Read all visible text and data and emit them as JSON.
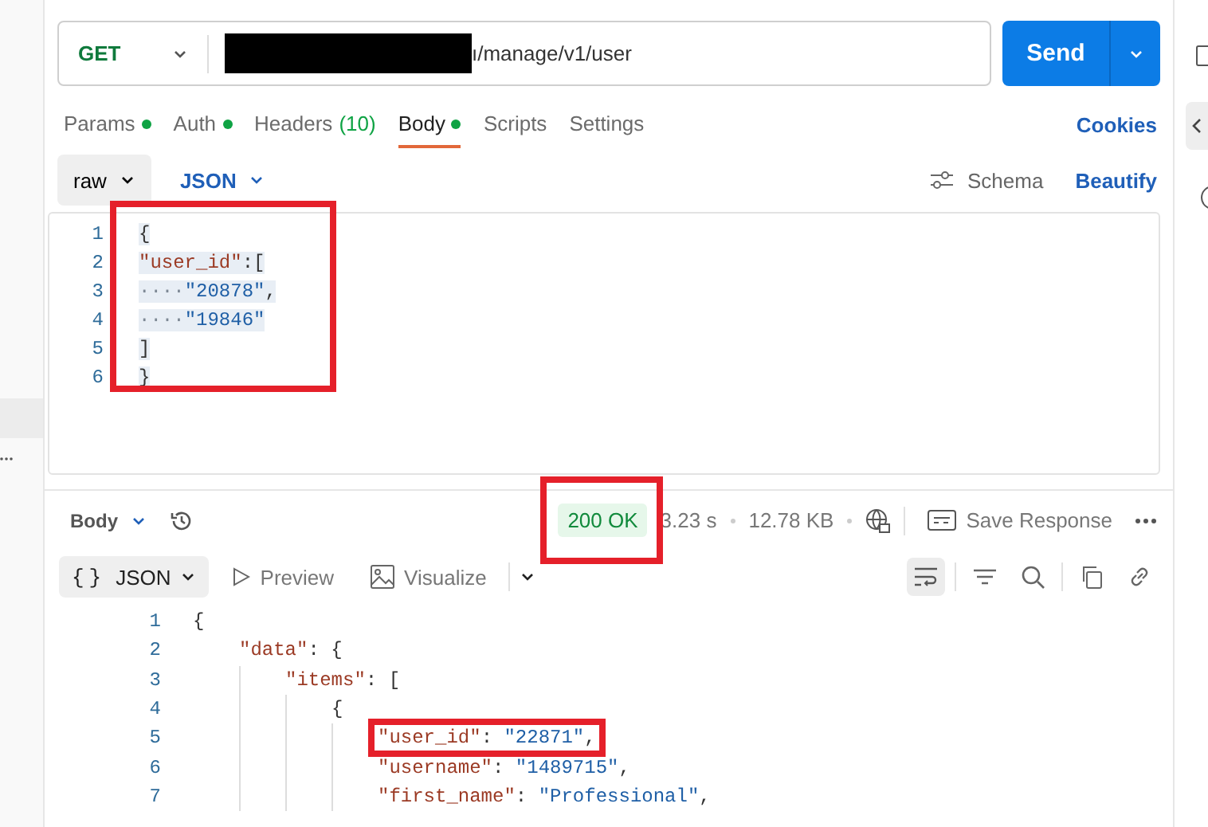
{
  "request": {
    "method": "GET",
    "url": "ı/manage/v1/user",
    "url_redacted": true,
    "send": "Send"
  },
  "request_tabs": [
    {
      "label": "Params",
      "dot": true,
      "selected": false
    },
    {
      "label": "Auth",
      "dot": true,
      "selected": false
    },
    {
      "label": "Headers",
      "count": "(10)",
      "dot": false,
      "selected": false
    },
    {
      "label": "Body",
      "dot": true,
      "selected": true
    },
    {
      "label": "Scripts",
      "dot": false,
      "selected": false
    },
    {
      "label": "Settings",
      "dot": false,
      "selected": false
    }
  ],
  "cookies": "Cookies",
  "body_options": {
    "mode": "raw",
    "format": "JSON",
    "schema": "Schema",
    "beautify": "Beautify"
  },
  "request_body": {
    "highlighted": true,
    "lines": [
      {
        "number": "1",
        "tokens": [
          {
            "kind": "punct",
            "text": "{"
          }
        ]
      },
      {
        "number": "2",
        "tokens": [
          {
            "kind": "key",
            "text": "\"user_id\""
          },
          {
            "kind": "punct",
            "text": ":["
          }
        ]
      },
      {
        "number": "3",
        "tokens": [
          {
            "kind": "ws",
            "text": "····"
          },
          {
            "kind": "string",
            "text": "\"20878\""
          },
          {
            "kind": "punct",
            "text": ","
          }
        ]
      },
      {
        "number": "4",
        "tokens": [
          {
            "kind": "ws",
            "text": "····"
          },
          {
            "kind": "string",
            "text": "\"19846\""
          }
        ]
      },
      {
        "number": "5",
        "tokens": [
          {
            "kind": "punct",
            "text": "]"
          }
        ]
      },
      {
        "number": "6",
        "tokens": [
          {
            "kind": "punct",
            "text": "}"
          }
        ]
      }
    ]
  },
  "response_bar": {
    "label": "Body",
    "status": "200 OK",
    "status_highlighted": true,
    "time": "3.23 s",
    "size": "12.78 KB",
    "save": "Save Response"
  },
  "response_views": [
    {
      "label": "JSON",
      "icon": "{}",
      "selected": true
    },
    {
      "label": "Preview",
      "selected": false
    },
    {
      "label": "Visualize",
      "selected": false
    }
  ],
  "response_body": {
    "lines": [
      {
        "number": "1",
        "highlighted": false,
        "tokens": [
          {
            "kind": "punct",
            "text": "{"
          }
        ],
        "children": [
          {
            "number": "2",
            "highlighted": false,
            "tokens": [
              {
                "kind": "key",
                "text": "\"data\""
              },
              {
                "kind": "punct",
                "text": ": {"
              }
            ],
            "children": [
              {
                "number": "3",
                "highlighted": false,
                "tokens": [
                  {
                    "kind": "key",
                    "text": "\"items\""
                  },
                  {
                    "kind": "punct",
                    "text": ": ["
                  }
                ],
                "children": [
                  {
                    "number": "4",
                    "highlighted": false,
                    "tokens": [
                      {
                        "kind": "punct",
                        "text": "{"
                      }
                    ],
                    "children": [
                      {
                        "number": "5",
                        "highlighted": true,
                        "tokens": [
                          {
                            "kind": "key",
                            "text": "\"user_id\""
                          },
                          {
                            "kind": "punct",
                            "text": ": "
                          },
                          {
                            "kind": "string",
                            "text": "\"22871\""
                          },
                          {
                            "kind": "punct",
                            "text": ","
                          }
                        ]
                      },
                      {
                        "number": "6",
                        "highlighted": false,
                        "tokens": [
                          {
                            "kind": "key",
                            "text": "\"username\""
                          },
                          {
                            "kind": "punct",
                            "text": ": "
                          },
                          {
                            "kind": "string",
                            "text": "\"1489715\""
                          },
                          {
                            "kind": "punct",
                            "text": ","
                          }
                        ]
                      },
                      {
                        "number": "7",
                        "highlighted": false,
                        "tokens": [
                          {
                            "kind": "key",
                            "text": "\"first_name\""
                          },
                          {
                            "kind": "punct",
                            "text": ": "
                          },
                          {
                            "kind": "string",
                            "text": "\"Professional\""
                          },
                          {
                            "kind": "punct",
                            "text": ","
                          }
                        ]
                      }
                    ]
                  }
                ]
              }
            ]
          }
        ]
      }
    ]
  }
}
